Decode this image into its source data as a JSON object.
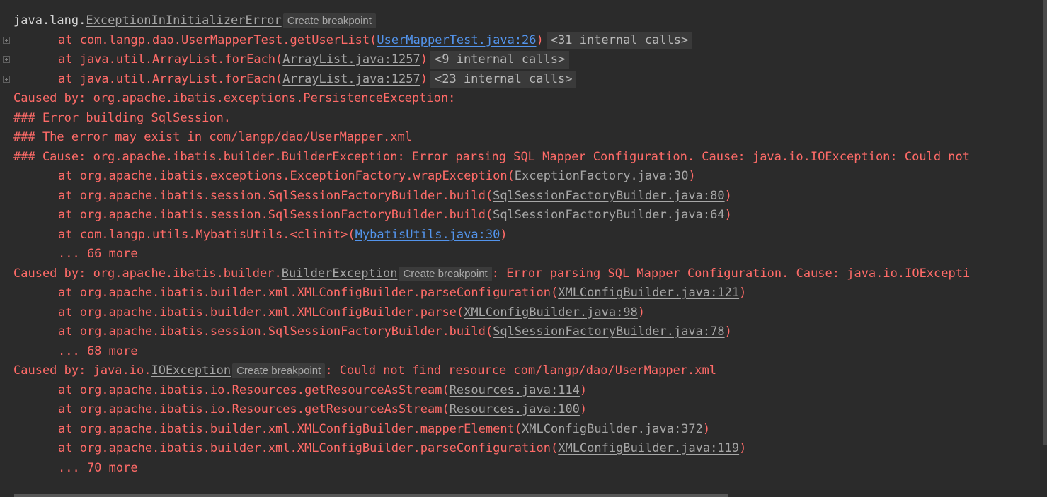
{
  "lines": {
    "l0": {
      "prefix": "java.lang.",
      "cls": "ExceptionInInitializerError",
      "bp": "Create breakpoint"
    },
    "l1": {
      "at": "at com.langp.dao.UserMapperTest.getUserList(",
      "loc": "UserMapperTest.java:26",
      "close": ")",
      "internal": "<31 internal calls>"
    },
    "l2": {
      "at": "at java.util.ArrayList.forEach(",
      "loc": "ArrayList.java:1257",
      "close": ")",
      "internal": "<9 internal calls>"
    },
    "l3": {
      "at": "at java.util.ArrayList.forEach(",
      "loc": "ArrayList.java:1257",
      "close": ")",
      "internal": "<23 internal calls>"
    },
    "l4": {
      "text": "Caused by: org.apache.ibatis.exceptions.PersistenceException:"
    },
    "l5": {
      "text": "### Error building SqlSession."
    },
    "l6": {
      "text": "### The error may exist in com/langp/dao/UserMapper.xml"
    },
    "l7": {
      "text": "### Cause: org.apache.ibatis.builder.BuilderException: Error parsing SQL Mapper Configuration. Cause: java.io.IOException: Could not"
    },
    "l8": {
      "at": "at org.apache.ibatis.exceptions.ExceptionFactory.wrapException(",
      "loc": "ExceptionFactory.java:30",
      "close": ")"
    },
    "l9": {
      "at": "at org.apache.ibatis.session.SqlSessionFactoryBuilder.build(",
      "loc": "SqlSessionFactoryBuilder.java:80",
      "close": ")"
    },
    "l10": {
      "at": "at org.apache.ibatis.session.SqlSessionFactoryBuilder.build(",
      "loc": "SqlSessionFactoryBuilder.java:64",
      "close": ")"
    },
    "l11": {
      "at": "at com.langp.utils.MybatisUtils.<clinit>(",
      "loc": "MybatisUtils.java:30",
      "close": ")"
    },
    "l12": {
      "text": "... 66 more"
    },
    "l13": {
      "prefix": "Caused by: org.apache.ibatis.builder.",
      "cls": "BuilderException",
      "bp": "Create breakpoint",
      "suffix": ": Error parsing SQL Mapper Configuration. Cause: java.io.IOExcepti"
    },
    "l14": {
      "at": "at org.apache.ibatis.builder.xml.XMLConfigBuilder.parseConfiguration(",
      "loc": "XMLConfigBuilder.java:121",
      "close": ")"
    },
    "l15": {
      "at": "at org.apache.ibatis.builder.xml.XMLConfigBuilder.parse(",
      "loc": "XMLConfigBuilder.java:98",
      "close": ")"
    },
    "l16": {
      "at": "at org.apache.ibatis.session.SqlSessionFactoryBuilder.build(",
      "loc": "SqlSessionFactoryBuilder.java:78",
      "close": ")"
    },
    "l17": {
      "text": "... 68 more"
    },
    "l18": {
      "prefix": "Caused by: java.io.",
      "cls": "IOException",
      "bp": "Create breakpoint",
      "suffix": ": Could not find resource com/langp/dao/UserMapper.xml"
    },
    "l19": {
      "at": "at org.apache.ibatis.io.Resources.getResourceAsStream(",
      "loc": "Resources.java:114",
      "close": ")"
    },
    "l20": {
      "at": "at org.apache.ibatis.io.Resources.getResourceAsStream(",
      "loc": "Resources.java:100",
      "close": ")"
    },
    "l21": {
      "at": "at org.apache.ibatis.builder.xml.XMLConfigBuilder.mapperElement(",
      "loc": "XMLConfigBuilder.java:372",
      "close": ")"
    },
    "l22": {
      "at": "at org.apache.ibatis.builder.xml.XMLConfigBuilder.parseConfiguration(",
      "loc": "XMLConfigBuilder.java:119",
      "close": ")"
    },
    "l23": {
      "text": "... 70 more"
    }
  },
  "colors": {
    "background": "#2b2b2b",
    "error_text": "#ff6b68",
    "link_gray": "#a7a7a7",
    "link_blue": "#5394ec",
    "internal_calls_bg": "#3a3a3a"
  },
  "icons": {
    "fold": "plus-square-icon"
  }
}
